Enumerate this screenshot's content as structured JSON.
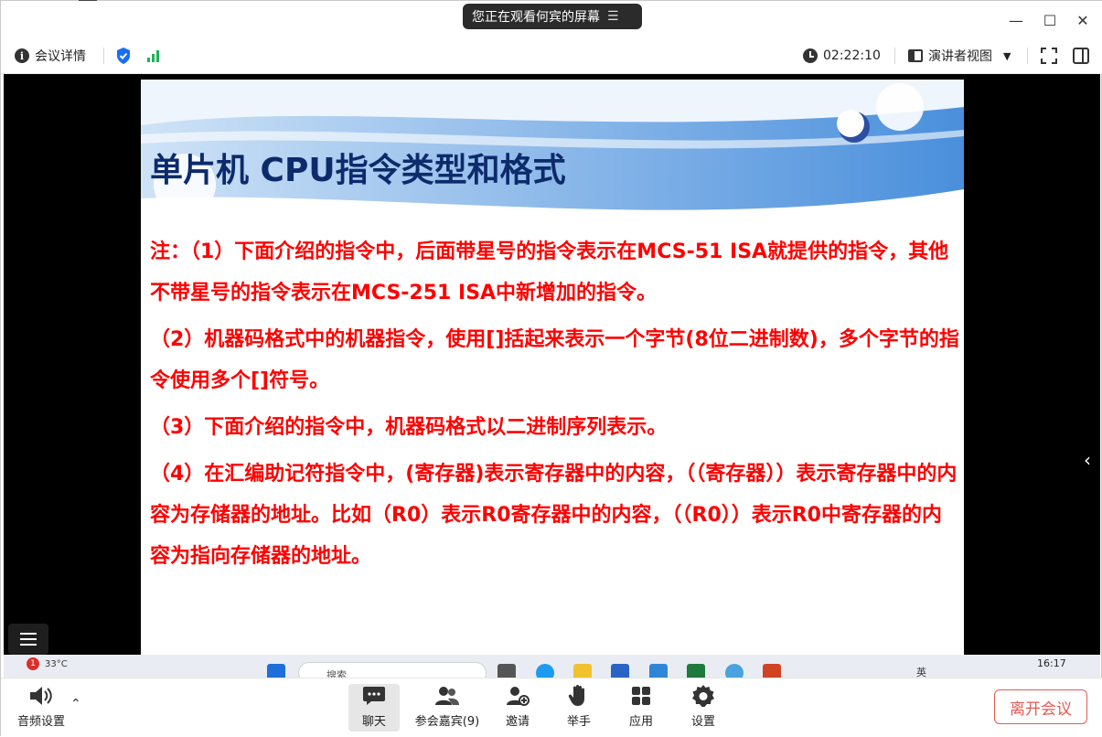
{
  "titlebar": {
    "share_status": "您正在观看何宾的屏幕",
    "menu_icon": "list-icon",
    "minimize": "—",
    "maximize": "☐",
    "close": "✕"
  },
  "toolbar": {
    "meeting_details": "会议详情",
    "timer": "02:22:10",
    "view_mode": "演讲者视图",
    "security_color": "#1a6ef5",
    "signal_color": "#1fb35b"
  },
  "slide": {
    "title": "单片机 CPU指令类型和格式",
    "title_color": "#0d2b6b",
    "body_color": "#ff0000",
    "paragraphs": [
      "注：（1）下面介绍的指令中，后面带星号的指令表示在MCS-51 ISA就提供的指令，其他不带星号的指令表示在MCS-251 ISA中新增加的指令。",
      "（2）机器码格式中的机器指令，使用[]括起来表示一个字节(8位二进制数)，多个字节的指令使用多个[]符号。",
      "（3）下面介绍的指令中，机器码格式以二进制序列表示。",
      "（4）在汇编助记符指令中，(寄存器)表示寄存器中的内容，（（寄存器））表示寄存器中的内容为存储器的地址。比如（R0）表示R0寄存器中的内容，（（R0））表示R0中寄存器的内容为指向存储器的地址。"
    ]
  },
  "taskbar": {
    "weather_badge": "1",
    "weather": "33°C",
    "search_placeholder": "搜索",
    "time": "16:17",
    "lang": "英"
  },
  "controls": {
    "audio_settings": "音频设置",
    "chat": "聊天",
    "participants": "参会嘉宾(9)",
    "invite": "邀请",
    "raise_hand": "举手",
    "apps": "应用",
    "settings": "设置",
    "leave": "离开会议",
    "leave_color": "#e25b55"
  }
}
